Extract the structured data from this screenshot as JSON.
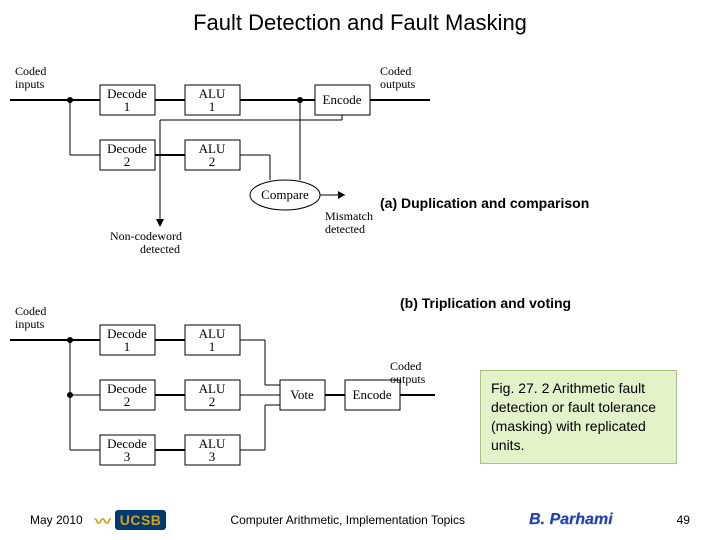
{
  "title": "Fault Detection and Fault Masking",
  "captions": {
    "a": "(a) Duplication and comparison",
    "b": "(b) Triplication and voting"
  },
  "figbox": "Fig. 27. 2   Arithmetic fault detection or fault tolerance (masking) with replicated units.",
  "diagramA": {
    "coded_inputs": "Coded\ninputs",
    "decode1": "Decode\n1",
    "decode2": "Decode\n2",
    "alu1": "ALU\n1",
    "alu2": "ALU\n2",
    "encode": "Encode",
    "compare": "Compare",
    "coded_outputs": "Coded\noutputs",
    "noncodeword": "Non-codeword\ndetected",
    "mismatch": "Mismatch\ndetected"
  },
  "diagramB": {
    "coded_inputs": "Coded\ninputs",
    "decode1": "Decode\n1",
    "decode2": "Decode\n2",
    "decode3": "Decode\n3",
    "alu1": "ALU\n1",
    "alu2": "ALU\n2",
    "alu3": "ALU\n3",
    "vote": "Vote",
    "encode": "Encode",
    "coded_outputs": "Coded\noutputs"
  },
  "footer": {
    "date": "May 2010",
    "center": "Computer Arithmetic, Implementation Topics",
    "author": "B. Parhami",
    "page": "49",
    "logo_text": "UCSB"
  }
}
